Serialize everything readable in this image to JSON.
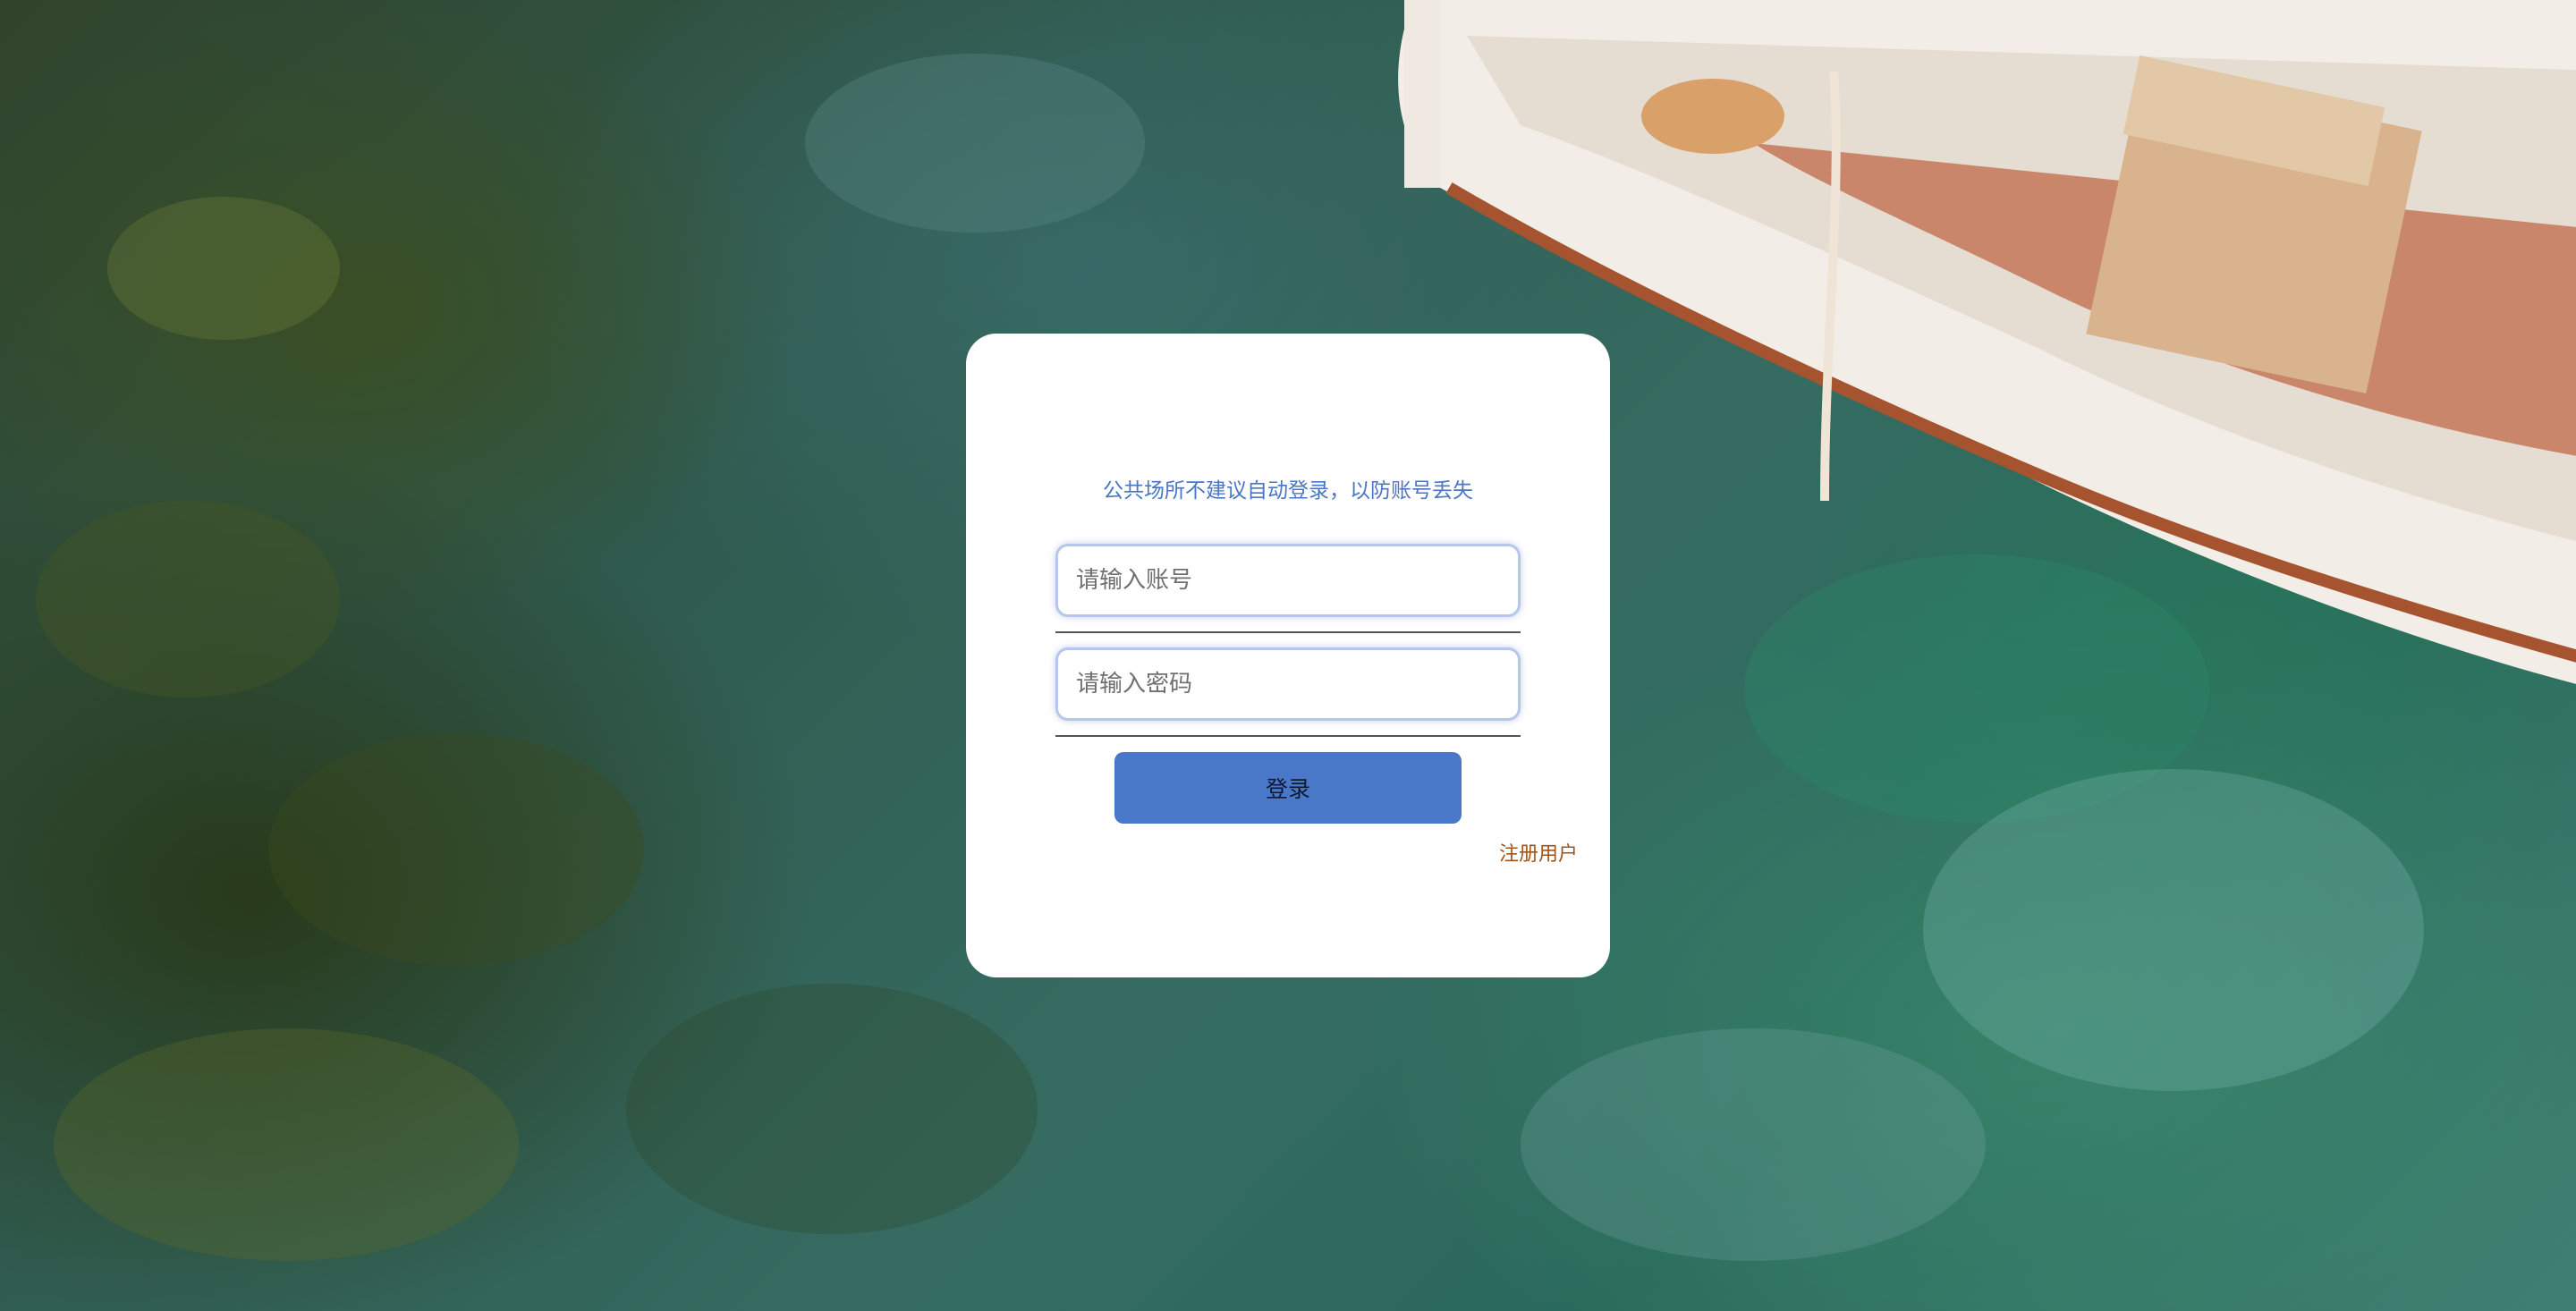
{
  "login": {
    "notice": "公共场所不建议自动登录，以防账号丢失",
    "account_placeholder": "请输入账号",
    "password_placeholder": "请输入密码",
    "login_label": "登录",
    "register_label": "注册用户"
  },
  "colors": {
    "notice_text": "#4a76c4",
    "button": "#4a78c8",
    "register_link": "#a0541a"
  }
}
